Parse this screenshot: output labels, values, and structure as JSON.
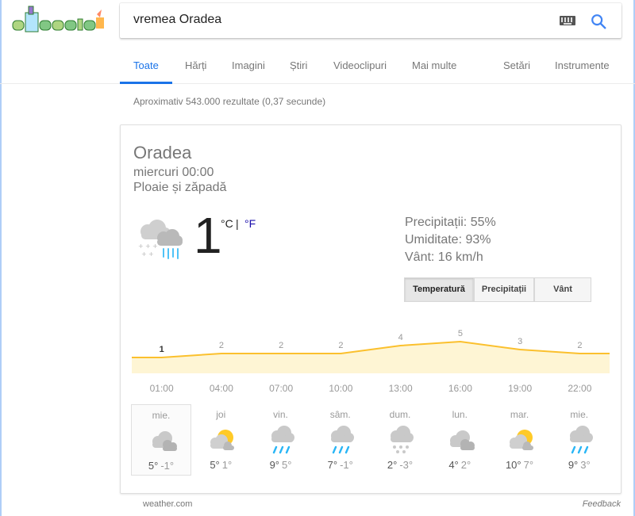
{
  "search": {
    "query": "vremea Oradea"
  },
  "tabs": {
    "all": "Toate",
    "maps": "Hărți",
    "images": "Imagini",
    "news": "Știri",
    "videos": "Videoclipuri",
    "more": "Mai multe",
    "settings": "Setări",
    "tools": "Instrumente"
  },
  "result_stats": "Aproximativ 543.000 rezultate (0,37 secunde)",
  "weather": {
    "city": "Oradea",
    "daytime": "miercuri 00:00",
    "condition": "Ploaie și zăpadă",
    "temperature": "1",
    "unit_c": "°C",
    "unit_sep": "|",
    "unit_f": "°F",
    "precip": "Precipitații: 55%",
    "humidity": "Umiditate: 93%",
    "wind": "Vânt: 16 km/h",
    "chart_tabs": [
      "Temperatură",
      "Precipitații",
      "Vânt"
    ],
    "source": "weather.com",
    "feedback": "Feedback"
  },
  "chart_data": {
    "type": "area",
    "x": [
      "01:00",
      "04:00",
      "07:00",
      "10:00",
      "13:00",
      "16:00",
      "19:00",
      "22:00"
    ],
    "values": [
      1,
      2,
      2,
      2,
      4,
      5,
      3,
      2
    ],
    "unit": "°C",
    "color": "#fbc02d",
    "fill": "#fef5d4"
  },
  "forecast": [
    {
      "day": "mie.",
      "hi": "5°",
      "lo": "-1°",
      "icon": "cloudy-icon"
    },
    {
      "day": "joi",
      "hi": "5°",
      "lo": "1°",
      "icon": "partly-sunny-icon"
    },
    {
      "day": "vin.",
      "hi": "9°",
      "lo": "5°",
      "icon": "rain-cloud-icon"
    },
    {
      "day": "sâm.",
      "hi": "7°",
      "lo": "-1°",
      "icon": "rain-cloud-icon"
    },
    {
      "day": "dum.",
      "hi": "2°",
      "lo": "-3°",
      "icon": "snow-cloud-icon"
    },
    {
      "day": "lun.",
      "hi": "4°",
      "lo": "2°",
      "icon": "cloudy-icon"
    },
    {
      "day": "mar.",
      "hi": "10°",
      "lo": "7°",
      "icon": "partly-sunny-icon"
    },
    {
      "day": "mie.",
      "hi": "9°",
      "lo": "3°",
      "icon": "rain-cloud-icon"
    }
  ],
  "colors": {
    "accent": "#1a73e8",
    "link": "#1a0dab",
    "chart_line": "#fbc02d",
    "rain": "#4fc3f7"
  }
}
